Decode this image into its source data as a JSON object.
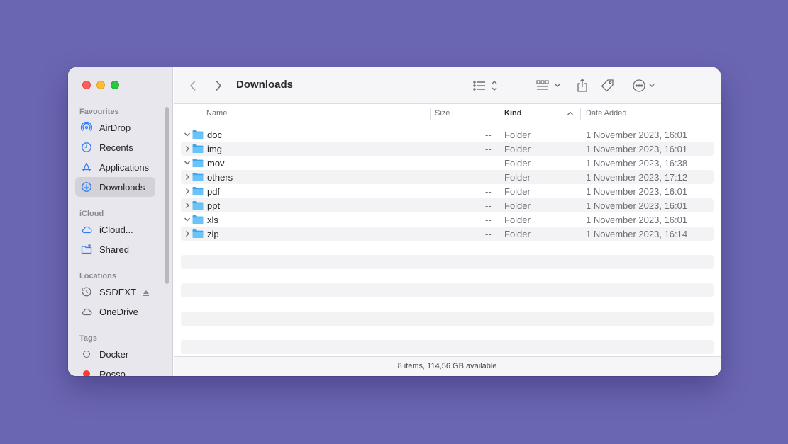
{
  "window": {
    "title": "Downloads"
  },
  "sidebar": {
    "favourites_label": "Favourites",
    "favourites": [
      {
        "label": "AirDrop",
        "icon": "airdrop-icon"
      },
      {
        "label": "Recents",
        "icon": "clock-icon"
      },
      {
        "label": "Applications",
        "icon": "applications-icon"
      },
      {
        "label": "Downloads",
        "icon": "download-icon",
        "active": true
      }
    ],
    "icloud_label": "iCloud",
    "icloud": [
      {
        "label": "iCloud...",
        "icon": "cloud-icon"
      },
      {
        "label": "Shared",
        "icon": "shared-folder-icon"
      }
    ],
    "locations_label": "Locations",
    "locations": [
      {
        "label": "SSDEXT",
        "icon": "time-machine-icon"
      },
      {
        "label": "OneDrive",
        "icon": "cloud-icon"
      }
    ],
    "tags_label": "Tags",
    "tags": [
      {
        "label": "Docker",
        "color": "#ffffff"
      },
      {
        "label": "Rosso",
        "color": "#ff3b30"
      }
    ]
  },
  "columns": {
    "name": "Name",
    "size": "Size",
    "kind": "Kind",
    "date": "Date Added"
  },
  "files": [
    {
      "name": "doc",
      "size": "--",
      "kind": "Folder",
      "date": "1 November 2023, 16:01",
      "expanded": true
    },
    {
      "name": "img",
      "size": "--",
      "kind": "Folder",
      "date": "1 November 2023, 16:01",
      "expanded": false
    },
    {
      "name": "mov",
      "size": "--",
      "kind": "Folder",
      "date": "1 November 2023, 16:38",
      "expanded": true
    },
    {
      "name": "others",
      "size": "--",
      "kind": "Folder",
      "date": "1 November 2023, 17:12",
      "expanded": false
    },
    {
      "name": "pdf",
      "size": "--",
      "kind": "Folder",
      "date": "1 November 2023, 16:01",
      "expanded": false
    },
    {
      "name": "ppt",
      "size": "--",
      "kind": "Folder",
      "date": "1 November 2023, 16:01",
      "expanded": false
    },
    {
      "name": "xls",
      "size": "--",
      "kind": "Folder",
      "date": "1 November 2023, 16:01",
      "expanded": true
    },
    {
      "name": "zip",
      "size": "--",
      "kind": "Folder",
      "date": "1 November 2023, 16:14",
      "expanded": false
    }
  ],
  "status": "8 items, 114,56 GB available",
  "colors": {
    "background": "#6b66b2",
    "accent": "#2f7ef6",
    "folder": "#5fb5f0"
  }
}
